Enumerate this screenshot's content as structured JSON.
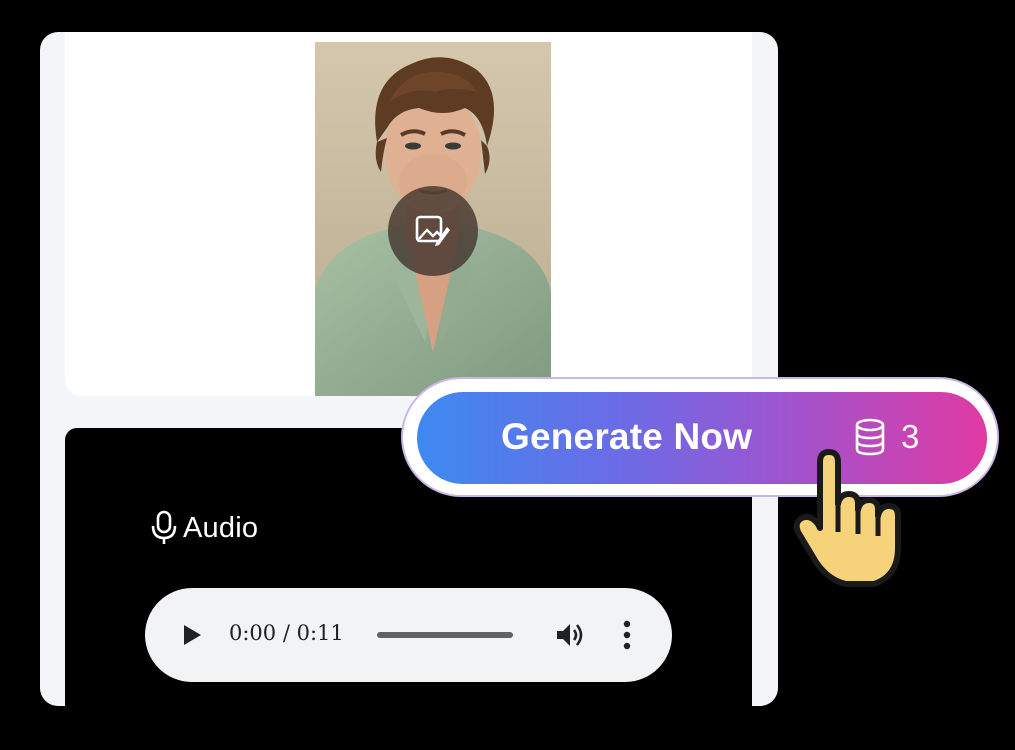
{
  "image_panel": {
    "portrait_alt": "",
    "edit_icon": "image-edit-icon"
  },
  "audio": {
    "label": "Audio",
    "icon": "microphone-icon",
    "player": {
      "time": "0:00 / 0:11",
      "progress": 0,
      "play_icon": "play-icon",
      "volume_icon": "volume-icon",
      "more_icon": "more-vertical-icon"
    }
  },
  "generate": {
    "label": "Generate Now",
    "credit_icon": "database-icon",
    "credits": "3",
    "gradient": [
      "#3d8af0",
      "#9a56d2",
      "#e03aa2"
    ]
  },
  "cursor": {
    "icon": "hand-pointer-icon",
    "color": "#f6d37a"
  }
}
